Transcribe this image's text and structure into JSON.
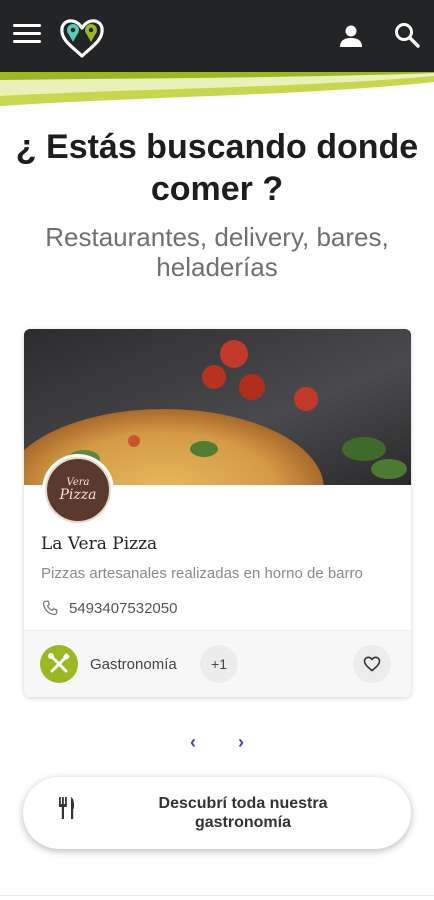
{
  "header": {
    "menu_icon": "hamburger-menu-icon",
    "logo_icon": "map-pin-heart-logo-icon",
    "user_icon": "user-icon",
    "search_icon": "search-icon",
    "background_color": "#222426",
    "accent_color": "#c7d64a"
  },
  "hero": {
    "title": "¿ Estás buscando donde comer ?",
    "subtitle": "Restaurantes, delivery, bares, heladerías"
  },
  "card": {
    "avatar_text_top": "Vera",
    "avatar_text_bottom": "Pizza",
    "name": "La Vera Pizza",
    "description": "Pizzas artesanales realizadas en horno de barro",
    "phone": "5493407532050",
    "category": "Gastronomía",
    "more_count": "+1",
    "category_color": "#9ab81f"
  },
  "pager": {
    "prev": "‹",
    "next": "›"
  },
  "cta": {
    "label": "Descubrí toda nuestra gastronomía",
    "icon": "fork-knife-icon"
  }
}
